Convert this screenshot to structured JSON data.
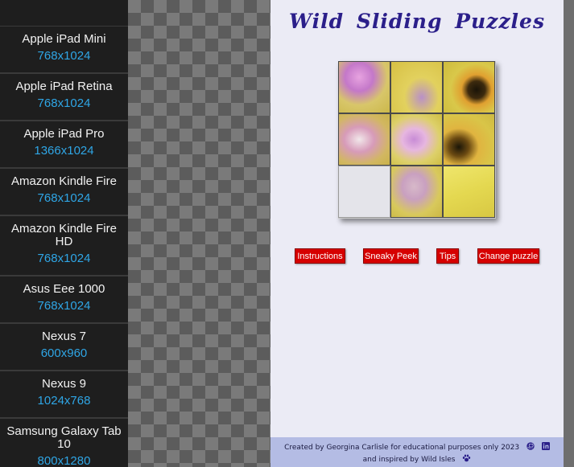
{
  "devices": [
    {
      "name": "Apple iPad Mini",
      "resolution": "768x1024"
    },
    {
      "name": "Apple iPad Retina",
      "resolution": "768x1024"
    },
    {
      "name": "Apple iPad Pro",
      "resolution": "1366x1024"
    },
    {
      "name": "Amazon Kindle Fire",
      "resolution": "768x1024"
    },
    {
      "name": "Amazon Kindle Fire HD",
      "resolution": "768x1024"
    },
    {
      "name": "Asus Eee 1000",
      "resolution": "768x1024"
    },
    {
      "name": "Nexus 7",
      "resolution": "600x960"
    },
    {
      "name": "Nexus 9",
      "resolution": "1024x768"
    },
    {
      "name": "Samsung Galaxy Tab 10",
      "resolution": "800x1280"
    }
  ],
  "app": {
    "title": "Wild Sliding Puzzles",
    "buttons": {
      "instructions": "Instructions",
      "sneaky_peek": "Sneaky Peek",
      "tips": "Tips",
      "change_puzzle": "Change puzzle"
    },
    "footer": {
      "credit": "Created by Georgina Carlisle for educational purposes only 2023",
      "inspired": "and inspired by Wild Isles",
      "icons": [
        "github-icon",
        "linkedin-icon",
        "paw-icon"
      ]
    }
  },
  "colors": {
    "title": "#2b1f8a",
    "button_bg": "#d60000",
    "resolution_text": "#2fa6e6",
    "footer_bg": "#b4bce4",
    "viewport_bg": "#ebebf5"
  }
}
